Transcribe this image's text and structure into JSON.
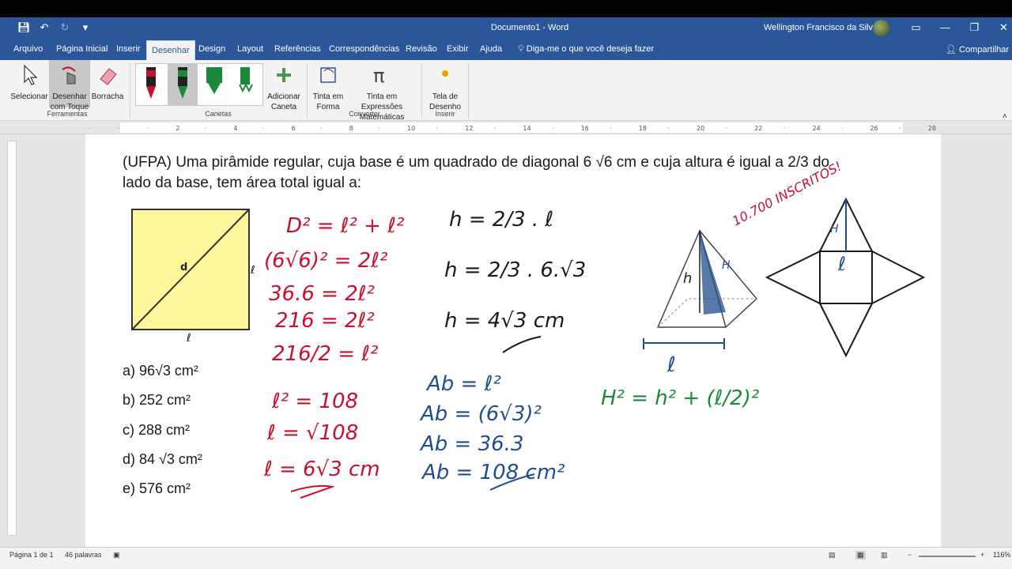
{
  "window": {
    "title": "Documento1  -  Word",
    "user": "Wellington Francisco da Silva"
  },
  "menu": {
    "tabs": [
      "Arquivo",
      "Página Inicial",
      "Inserir",
      "Desenhar",
      "Design",
      "Layout",
      "Referências",
      "Correspondências",
      "Revisão",
      "Exibir",
      "Ajuda"
    ],
    "active_tab": "Desenhar",
    "tell_me": "Diga-me o que você deseja fazer",
    "share": "Compartilhar"
  },
  "ribbon": {
    "select": "Selecionar",
    "draw_touch": "Desenhar com Toque",
    "eraser": "Borracha",
    "add_pen": "Adicionar Caneta",
    "ink_shape": "Tinta em Forma",
    "ink_math": "Tinta em Expressões Matemáticas",
    "canvas": "Tela de Desenho",
    "groups": {
      "tools": "Ferramentas",
      "pens": "Canetas",
      "convert": "Converter",
      "insert": "Inserir"
    }
  },
  "document": {
    "problem_line1": "(UFPA) Uma pirâmide regular, cuja base é um quadrado de diagonal 6 √6 cm e cuja altura é igual a 2/3 do",
    "problem_line2": "lado da base, tem área total igual a:",
    "options": [
      "a) 96√3 cm²",
      "b) 252 cm²",
      "c) 288 cm²",
      "d) 84 √3 cm²",
      "e) 576 cm²"
    ],
    "square_diag_label": "d",
    "square_side_label": "ℓ",
    "square_bottom_label": "ℓ"
  },
  "ink": {
    "red": [
      "D² = ℓ² + ℓ²",
      "(6√6)² = 2ℓ²",
      "36.6 = 2ℓ²",
      "216 = 2ℓ²",
      "216/2 = ℓ²",
      "ℓ² = 108",
      "ℓ = √108",
      "ℓ = 6√3 cm"
    ],
    "black": [
      "h = 2/3 . ℓ",
      "h = 2/3 . 6.√3",
      "h = 4√3 cm"
    ],
    "blue": [
      "Ab = ℓ²",
      "Ab = (6√3)²",
      "Ab = 36.3",
      "Ab = 108 cm²"
    ],
    "green": "H² = h² + (ℓ/2)²",
    "note": "10.700 INSCRITOS!",
    "pyramid_h": "h",
    "pyramid_H": "H",
    "pyramid_base": "ℓ",
    "net_H": "H",
    "net_l": "ℓ"
  },
  "status": {
    "page": "Página 1 de 1",
    "words": "46 palavras",
    "zoom": "116%"
  },
  "colors": {
    "word_blue": "#2b579a",
    "ink_red": "#c8102e",
    "ink_blue": "#1f4e8c",
    "ink_green": "#1a8a3a",
    "square_fill": "#fcf79a"
  }
}
